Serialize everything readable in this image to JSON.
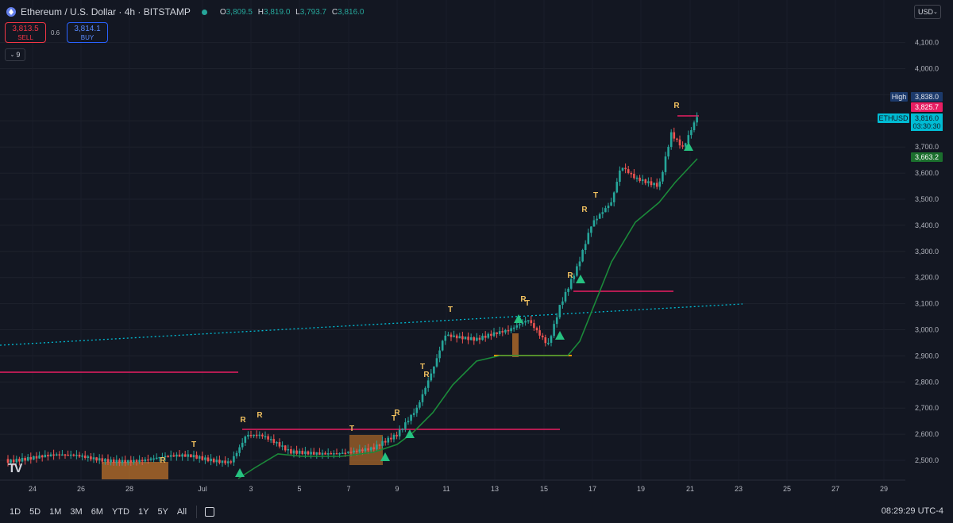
{
  "header": {
    "symbol_title": "Ethereum / U.S. Dollar · 4h · BITSTAMP",
    "ohlc": {
      "open_key": "O",
      "open": "3,809.5",
      "high_key": "H",
      "high": "3,819.0",
      "low_key": "L",
      "low": "3,793.7",
      "close_key": "C",
      "close": "3,816.0"
    },
    "sell_price": "3,813.5",
    "sell_label": "SELL",
    "spread": "0.6",
    "buy_price": "3,814.1",
    "buy_label": "BUY",
    "indicator_count": "9",
    "currency": "USD"
  },
  "price_axis": {
    "ticks": [
      "4,100.0",
      "4,000.0",
      "3,900.0",
      "3,800.0",
      "3,700.0",
      "3,600.0",
      "3,500.0",
      "3,400.0",
      "3,300.0",
      "3,200.0",
      "3,100.0",
      "3,000.0",
      "2,900.0",
      "2,800.0",
      "2,700.0",
      "2,600.0",
      "2,500.0"
    ],
    "high_tag": "High",
    "high_value": "3,838.0",
    "red_tag_value": "3,825.7",
    "ticker_tag": "ETHUSD",
    "last_price": "3,816.0",
    "countdown": "03:30:30",
    "green_tag_value": "3,663.2"
  },
  "time_axis": {
    "labels": [
      "24",
      "26",
      "28",
      "Jul",
      "3",
      "5",
      "7",
      "9",
      "11",
      "13",
      "15",
      "17",
      "19",
      "21",
      "23",
      "25",
      "27",
      "29"
    ]
  },
  "bottom_bar": {
    "ranges": [
      "1D",
      "5D",
      "1M",
      "3M",
      "6M",
      "YTD",
      "1Y",
      "5Y",
      "All"
    ],
    "clock": "08:29:29 UTC-4"
  },
  "chart_data": {
    "type": "candlestick",
    "symbol": "ETHUSD",
    "interval": "4h",
    "ylim": [
      2440,
      4180
    ],
    "series": [
      {
        "name": "ETHUSD",
        "x": [
          "24",
          "26",
          "28",
          "Jul",
          "3",
          "5",
          "7",
          "9",
          "11",
          "13",
          "15",
          "17",
          "19",
          "21"
        ],
        "values": [
          2455,
          2460,
          2470,
          2440,
          2590,
          2520,
          2540,
          2620,
          2990,
          2960,
          2990,
          3350,
          3560,
          3816
        ]
      }
    ],
    "signal_labels": [
      "R",
      "T",
      "R",
      "R",
      "T",
      "T",
      "R",
      "T",
      "R",
      "T",
      "R",
      "T",
      "R",
      "T",
      "R",
      "R"
    ],
    "colors": {
      "up": "#26a69a",
      "down": "#ef5350",
      "trend": "#1b8a3a",
      "resistance": "#e91e63",
      "support": "#ff9800",
      "trendline": "#00bcd4"
    }
  }
}
